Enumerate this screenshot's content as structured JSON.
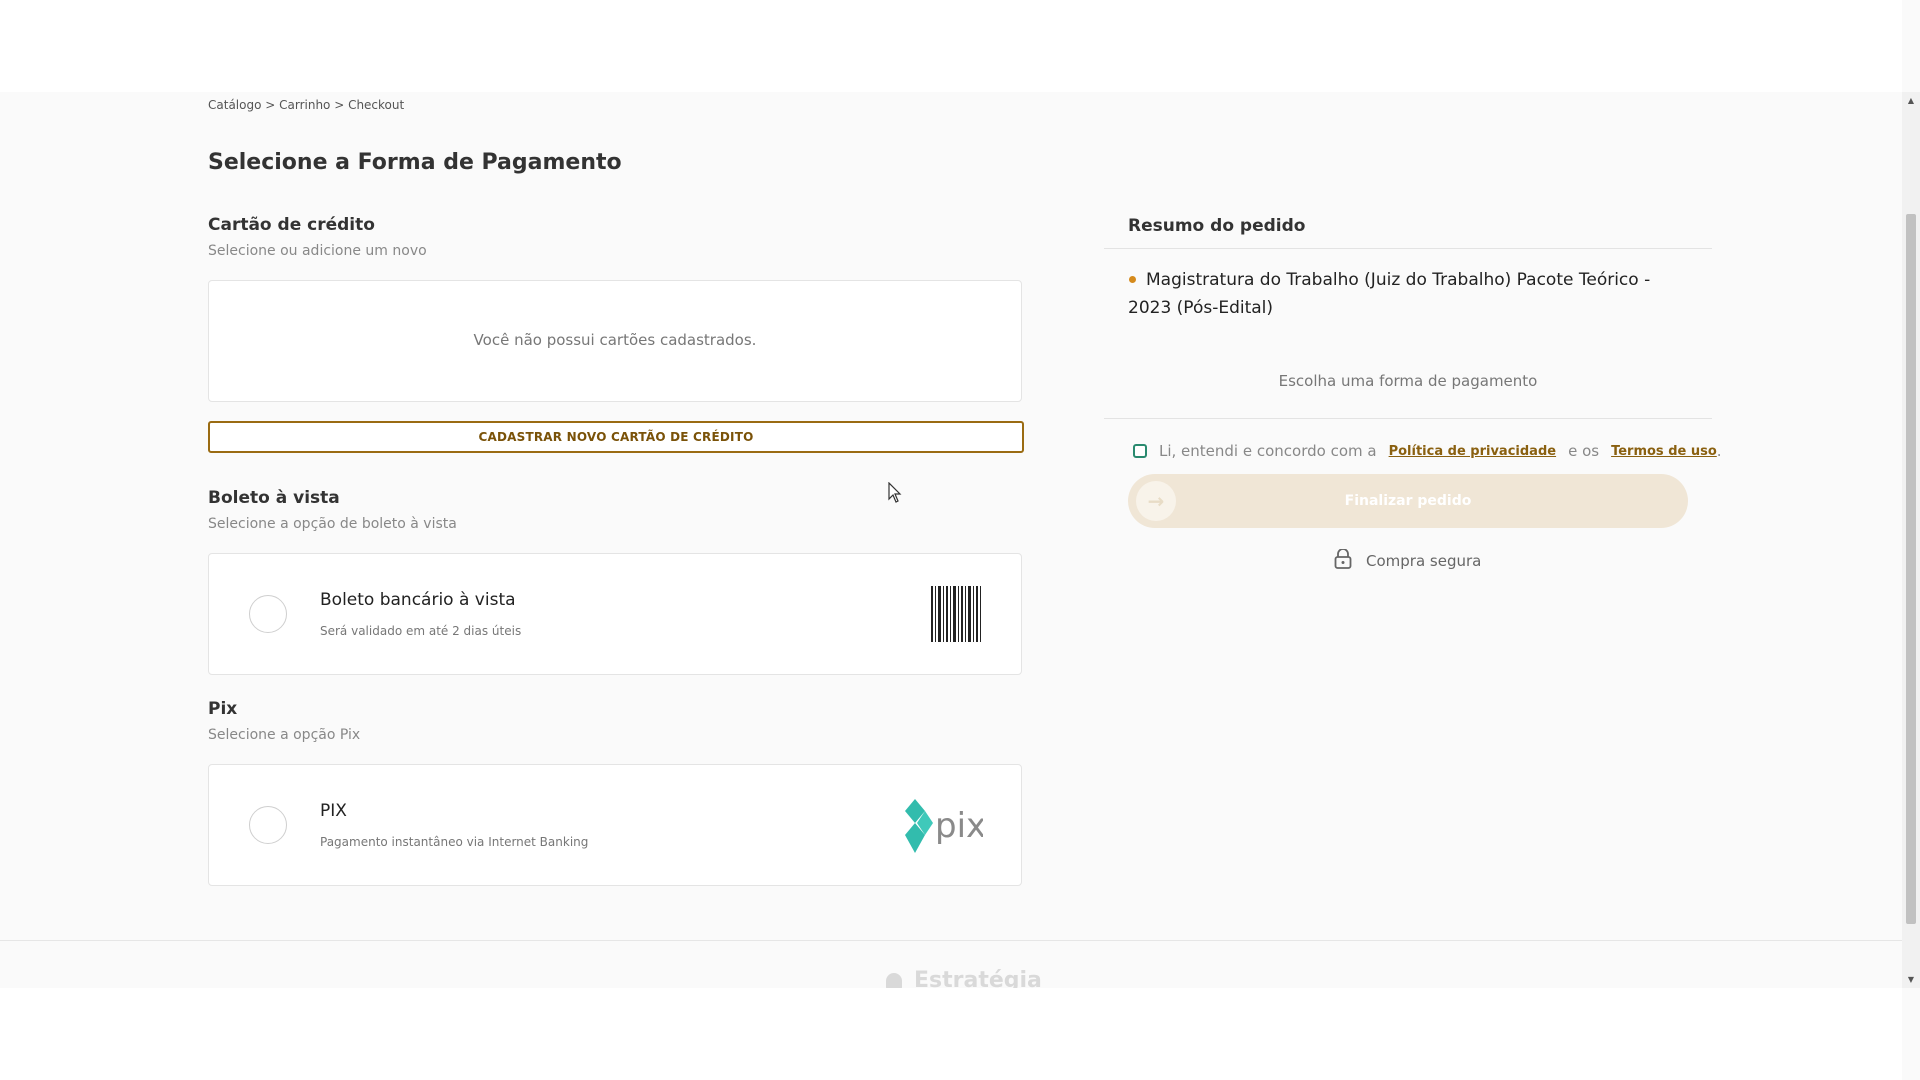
{
  "breadcrumb": {
    "text": "Catálogo > Carrinho > Checkout"
  },
  "page": {
    "title": "Selecione a Forma de Pagamento"
  },
  "credit_card": {
    "title": "Cartão de crédito",
    "subtitle": "Selecione ou adicione um novo",
    "empty_message": "Você não possui cartões cadastrados.",
    "add_button": "CADASTRAR NOVO CARTÃO DE CRÉDITO"
  },
  "boleto": {
    "title": "Boleto à vista",
    "subtitle": "Selecione a opção de boleto à vista",
    "option_title": "Boleto bancário à vista",
    "option_sub": "Será validado em até 2 dias úteis",
    "icon": "barcode-icon"
  },
  "pix": {
    "title": "Pix",
    "subtitle": "Selecione a opção Pix",
    "option_title": "PIX",
    "option_sub": "Pagamento instantâneo via Internet Banking",
    "logo_text": "pix",
    "icon": "pix-logo"
  },
  "summary": {
    "title": "Resumo do pedido",
    "product": "Magistratura do Trabalho (Juiz do Trabalho) Pacote Teórico - 2023 (Pós-Edital)",
    "pay_hint": "Escolha uma forma de pagamento",
    "terms_prefix": "Li, entendi e concordo com a",
    "privacy_link": "Política de privacidade",
    "terms_mid": "e os",
    "terms_link": "Termos de uso",
    "finish_button": "Finalizar pedido",
    "secure_text": "Compra segura"
  },
  "footer": {
    "brand": "Estratégia"
  },
  "colors": {
    "accent": "#9a6b12",
    "checkbox": "#2a8a6f",
    "bullet": "#d58a1c",
    "pix_green": "#32bcad"
  }
}
